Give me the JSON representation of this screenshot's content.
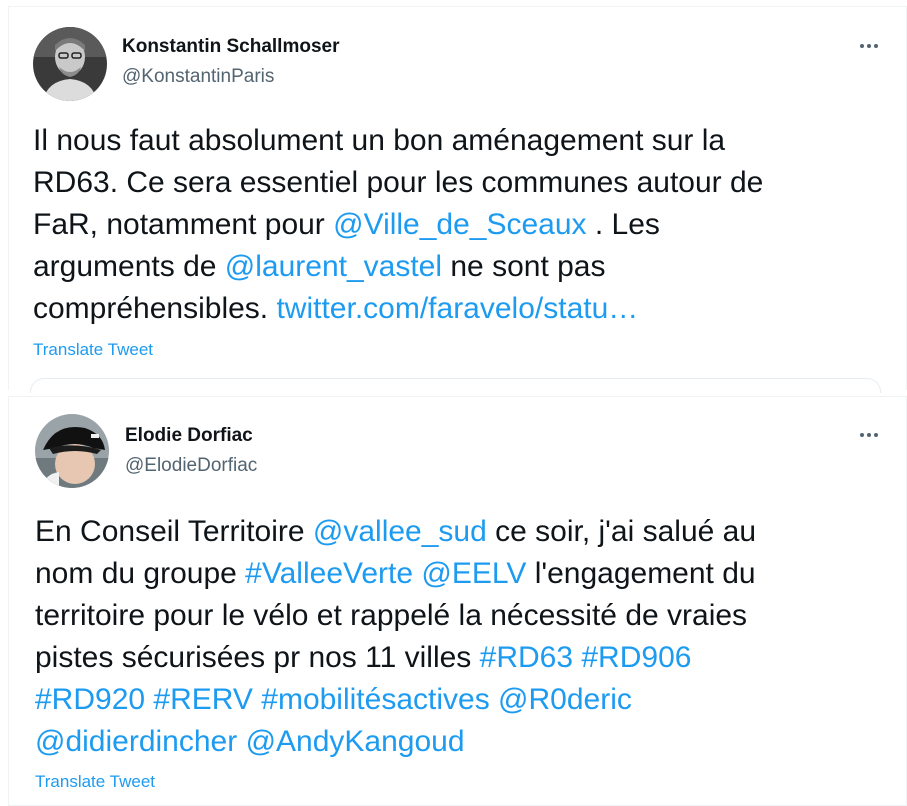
{
  "tweets": [
    {
      "author_name": "Konstantin Schallmoser",
      "handle": "@KonstantinParis",
      "more_icon": "more-horizontal-icon",
      "lines": [
        [
          {
            "t": "Il nous faut absolument un bon aménagement sur la"
          }
        ],
        [
          {
            "t": "RD63. Ce sera essentiel pour les communes autour de"
          }
        ],
        [
          {
            "t": "FaR, notamment pour "
          },
          {
            "t": "@Ville_de_Sceaux",
            "link": true
          },
          {
            "t": " . Les"
          }
        ],
        [
          {
            "t": "arguments de "
          },
          {
            "t": "@laurent_vastel",
            "link": true
          },
          {
            "t": " ne sont pas"
          }
        ],
        [
          {
            "t": "compréhensibles. "
          },
          {
            "t": "twitter.com/faravelo/statu…",
            "link": true
          }
        ]
      ],
      "translate_label": "Translate Tweet"
    },
    {
      "author_name": "Elodie Dorfiac",
      "handle": "@ElodieDorfiac",
      "more_icon": "more-horizontal-icon",
      "lines": [
        [
          {
            "t": "En Conseil Territoire "
          },
          {
            "t": "@vallee_sud",
            "link": true
          },
          {
            "t": " ce soir, j'ai salué au"
          }
        ],
        [
          {
            "t": "nom du groupe "
          },
          {
            "t": "#ValleeVerte",
            "link": true
          },
          {
            "t": " "
          },
          {
            "t": "@EELV",
            "link": true
          },
          {
            "t": " l'engagement du"
          }
        ],
        [
          {
            "t": "territoire pour le vélo et rappelé la nécessité de vraies"
          }
        ],
        [
          {
            "t": "pistes sécurisées pr nos 11 villes "
          },
          {
            "t": "#RD63",
            "link": true
          },
          {
            "t": " "
          },
          {
            "t": "#RD906",
            "link": true
          }
        ],
        [
          {
            "t": "#RD920",
            "link": true
          },
          {
            "t": " "
          },
          {
            "t": "#RERV",
            "link": true
          },
          {
            "t": " "
          },
          {
            "t": "#mobilitésactives",
            "link": true
          },
          {
            "t": " "
          },
          {
            "t": "@R0deric",
            "link": true
          }
        ],
        [
          {
            "t": "@didierdincher",
            "link": true
          },
          {
            "t": " "
          },
          {
            "t": "@AndyKangoud",
            "link": true
          }
        ]
      ],
      "translate_label": "Translate Tweet"
    }
  ],
  "colors": {
    "link": "#1d9bf0",
    "text": "#0f1419",
    "secondary": "#536471"
  }
}
